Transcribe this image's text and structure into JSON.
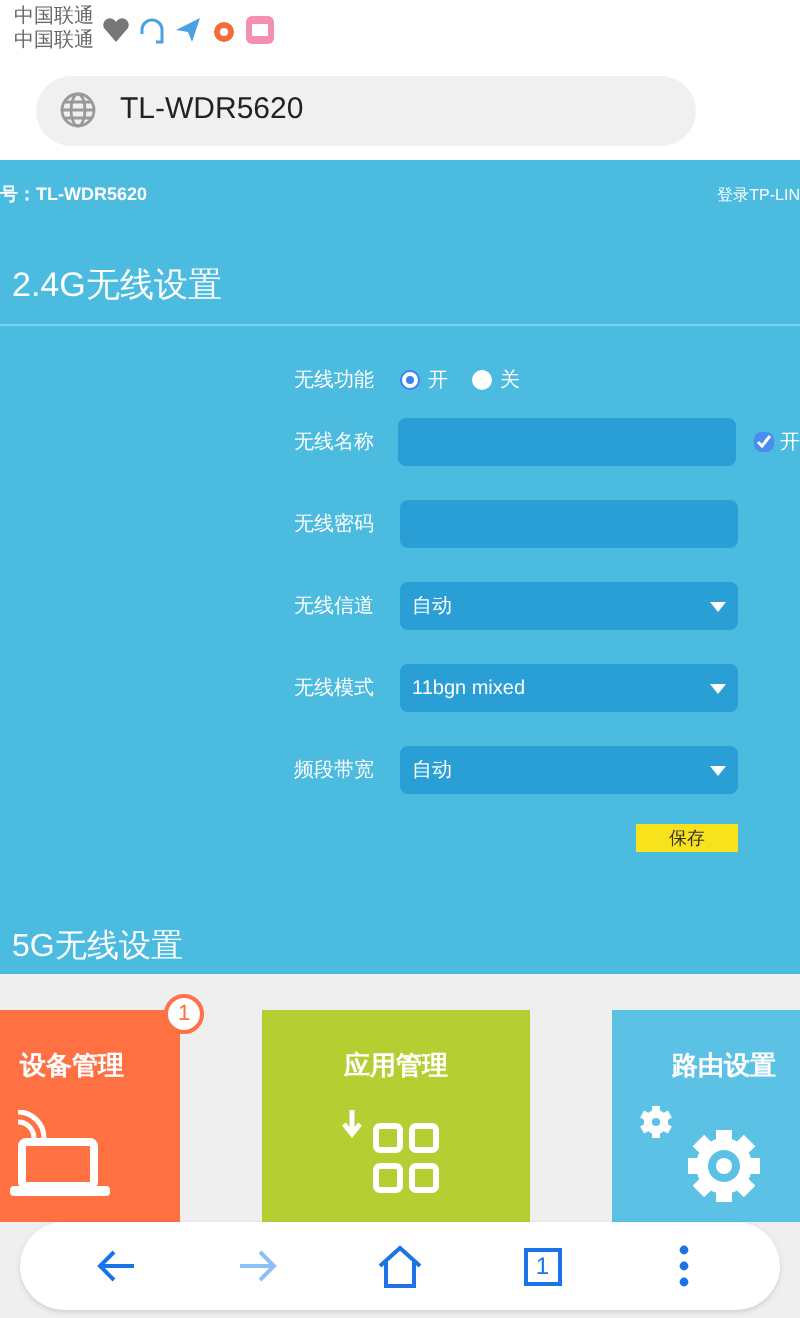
{
  "status_bar": {
    "carriers": [
      "中国联通",
      "中国联通"
    ]
  },
  "address_bar": {
    "url": "TL-WDR5620"
  },
  "header": {
    "model": "号：TL-WDR5620",
    "login": "登录TP-LIN"
  },
  "section_24g": {
    "title": "2.4G无线设置",
    "rows": [
      {
        "kind": "radio",
        "label": "无线功能",
        "options": [
          {
            "label": "开",
            "selected": true
          },
          {
            "label": "关",
            "selected": false
          }
        ]
      },
      {
        "kind": "text",
        "label": "无线名称",
        "checkbox": {
          "label": "开",
          "checked": true
        }
      },
      {
        "kind": "text",
        "label": "无线密码"
      },
      {
        "kind": "select",
        "label": "无线信道",
        "value": "自动"
      },
      {
        "kind": "select",
        "label": "无线模式",
        "value": "11bgn mixed"
      },
      {
        "kind": "select",
        "label": "频段带宽",
        "value": "自动"
      }
    ],
    "save_button": "保存"
  },
  "section_5g": {
    "title": "5G无线设置"
  },
  "tiles": [
    {
      "kind": "devices",
      "title": "设备管理",
      "color": "#ff7043",
      "badge": "1"
    },
    {
      "kind": "apps",
      "title": "应用管理",
      "color": "#b5cf33"
    },
    {
      "kind": "settings",
      "title": "路由设置",
      "color": "#5bc2e6"
    }
  ],
  "bottom_nav": [
    {
      "kind": "back",
      "disabled": false
    },
    {
      "kind": "forward",
      "disabled": true
    },
    {
      "kind": "home",
      "disabled": false
    },
    {
      "kind": "tabs",
      "label": "1",
      "disabled": false
    },
    {
      "kind": "menu",
      "disabled": false
    }
  ]
}
